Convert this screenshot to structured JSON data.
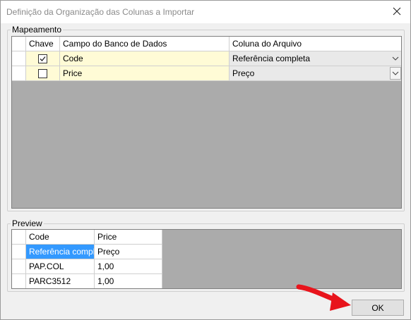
{
  "window": {
    "title": "Definição da Organização das Colunas a Importar"
  },
  "mapping": {
    "group_label": "Mapeamento",
    "headers": {
      "key": "Chave",
      "db_field": "Campo do Banco de Dados",
      "file_column": "Coluna do Arquivo"
    },
    "rows": [
      {
        "key_checked": true,
        "db_field": "Code",
        "file_column": "Referência completa"
      },
      {
        "key_checked": false,
        "db_field": "Price",
        "file_column": "Preço"
      }
    ]
  },
  "preview": {
    "group_label": "Preview",
    "headers": [
      "Code",
      "Price"
    ],
    "rows": [
      [
        "Referência compl...",
        "Preço"
      ],
      [
        "PAP.COL",
        "1,00"
      ],
      [
        "PARC3512",
        "1,00"
      ]
    ]
  },
  "buttons": {
    "ok": "OK"
  },
  "colors": {
    "annotation_arrow": "#e8141c",
    "selection": "#3399ff",
    "highlight_row": "#fffbd6"
  }
}
